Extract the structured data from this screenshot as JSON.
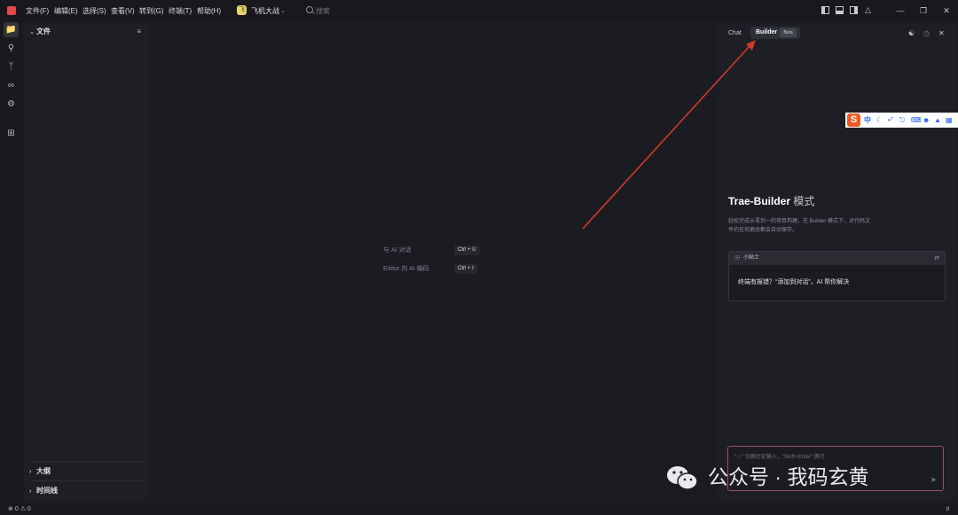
{
  "menu": [
    "文件(F)",
    "编辑(E)",
    "选择(S)",
    "查看(V)",
    "转到(G)",
    "终端(T)",
    "帮助(H)"
  ],
  "project": {
    "badge": "飞",
    "name": "飞机大战"
  },
  "search": {
    "placeholder": "搜索"
  },
  "explorer": {
    "files_title": "文件",
    "outline_title": "大纲",
    "timeline_title": "时间线"
  },
  "editor_hints": [
    {
      "label": "与 AI 对话",
      "keys": "Ctrl + U"
    },
    {
      "label": "Editor 内 AI 编码",
      "keys": "Ctrl + I"
    }
  ],
  "right_panel": {
    "tab_chat": "Chat",
    "tab_builder": "Builder",
    "beta": "Beta",
    "builder_title": "Trae-Builder",
    "builder_title_mode": "模式",
    "builder_desc_line1": "轻松完成从零到一的项目构建。在 Builder 模式下，对代码文",
    "builder_desc_line2": "件的任何更改都会自动保存。",
    "tips_title": "小贴士",
    "tips_text": "终端有报错？“添加到对话”，AI 帮你解决",
    "input_placeholder": "\"↑↓\" 切换历史输入，\"Shift+Enter\" 换行"
  },
  "ime": {
    "logo": "S",
    "lang": "中"
  },
  "watermark": "公众号 · 我码玄黄",
  "status": {
    "errors": "0",
    "warnings": "0"
  },
  "colors": {
    "accent_arrow": "#d0392b",
    "input_border": "#9a5060"
  }
}
